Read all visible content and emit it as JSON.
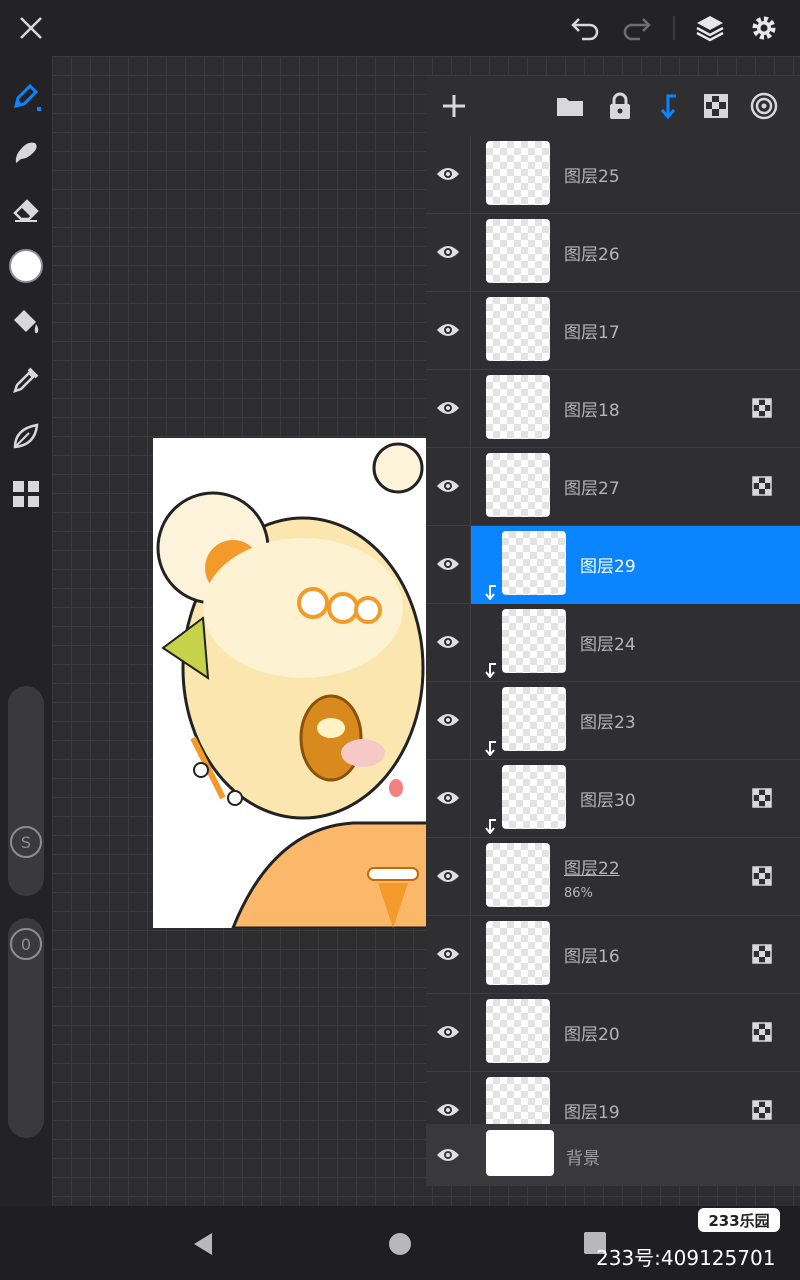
{
  "colors": {
    "accent": "#0a84ff",
    "icon": "#d8d8da",
    "icon_dim": "#6e6e70"
  },
  "topbar": {
    "icons": [
      "close-icon",
      "undo-icon",
      "redo-icon",
      "layers-icon",
      "settings-icon"
    ]
  },
  "tools": [
    "pen-icon",
    "smudge-icon",
    "eraser-icon",
    "color-swatch",
    "fill-bucket-icon",
    "eyedropper-icon",
    "leaf-icon",
    "grid-menu-icon"
  ],
  "sliders": {
    "size_label": "S",
    "opacity_label": "0"
  },
  "layers_panel": {
    "header_icons": [
      "add-icon",
      "folder-icon",
      "lock-icon",
      "clip-arrow-icon",
      "alpha-lock-icon",
      "target-icon"
    ],
    "layers": [
      {
        "name": "图层25",
        "sub": "",
        "selected": false,
        "clipped": false,
        "alpha_lock": false
      },
      {
        "name": "图层26",
        "sub": "",
        "selected": false,
        "clipped": false,
        "alpha_lock": false
      },
      {
        "name": "图层17",
        "sub": "",
        "selected": false,
        "clipped": false,
        "alpha_lock": false
      },
      {
        "name": "图层18",
        "sub": "",
        "selected": false,
        "clipped": false,
        "alpha_lock": true
      },
      {
        "name": "图层27",
        "sub": "",
        "selected": false,
        "clipped": false,
        "alpha_lock": true
      },
      {
        "name": "图层29",
        "sub": "",
        "selected": true,
        "clipped": true,
        "alpha_lock": false
      },
      {
        "name": "图层24",
        "sub": "",
        "selected": false,
        "clipped": true,
        "alpha_lock": false
      },
      {
        "name": "图层23",
        "sub": "",
        "selected": false,
        "clipped": true,
        "alpha_lock": false
      },
      {
        "name": "图层30",
        "sub": "",
        "selected": false,
        "clipped": true,
        "alpha_lock": true
      },
      {
        "name": "图层22",
        "sub": "86%",
        "selected": false,
        "clipped": false,
        "alpha_lock": true
      },
      {
        "name": "图层16",
        "sub": "",
        "selected": false,
        "clipped": false,
        "alpha_lock": true
      },
      {
        "name": "图层20",
        "sub": "",
        "selected": false,
        "clipped": false,
        "alpha_lock": true
      },
      {
        "name": "图层19",
        "sub": "",
        "selected": false,
        "clipped": false,
        "alpha_lock": true
      }
    ],
    "background_label": "背景"
  },
  "watermark": {
    "badge": "233乐园",
    "id": "233号:409125701"
  }
}
